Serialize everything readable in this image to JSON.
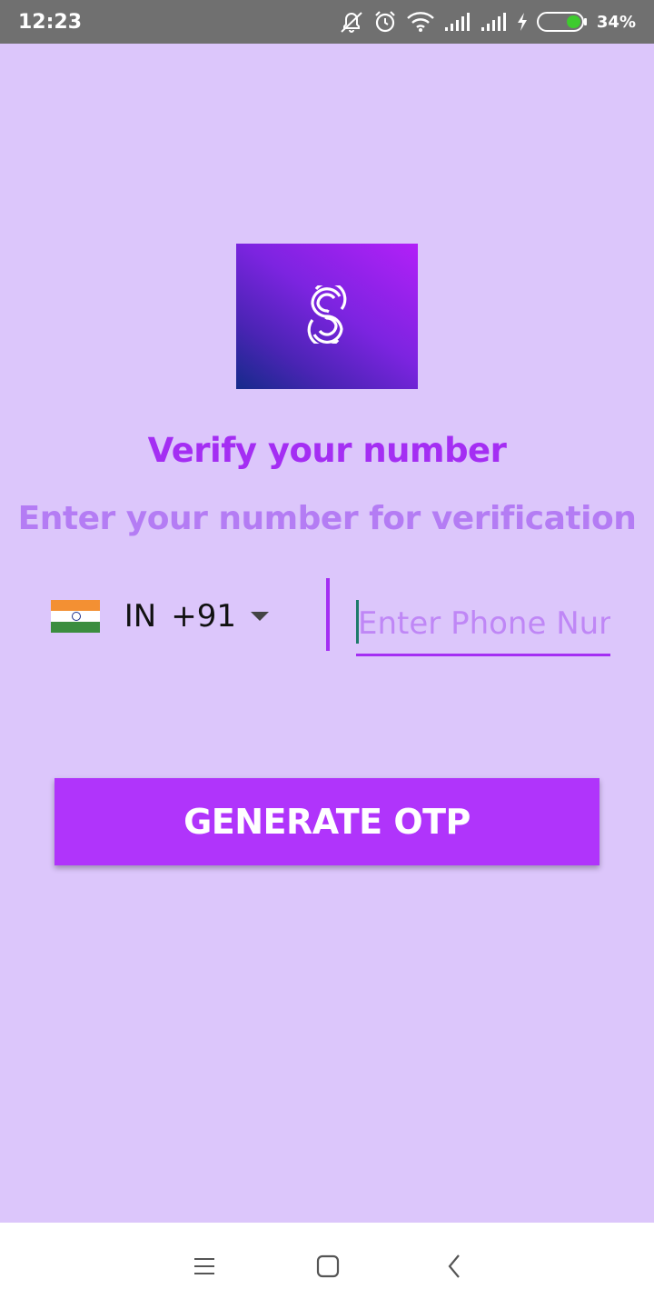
{
  "status_bar": {
    "time": "12:23",
    "battery_percent": "34%",
    "battery_level": 0.34,
    "icons": [
      "mute-icon",
      "alarm-icon",
      "wifi-icon",
      "signal-icon",
      "signal-icon",
      "charging-icon",
      "battery-icon"
    ]
  },
  "logo": {
    "icon": "app-logo-icon"
  },
  "verify": {
    "title": "Verify your number",
    "subtitle": "Enter your number for verification"
  },
  "country": {
    "flag": "india-flag-icon",
    "code": "IN",
    "dial_code": "+91"
  },
  "phone": {
    "placeholder": "Enter Phone Num",
    "value": ""
  },
  "button": {
    "label": "GENERATE OTP"
  },
  "colors": {
    "background": "#dcc6fb",
    "accent": "#a42ef3",
    "button": "#b034fb",
    "subtitle": "#b47cf4",
    "status_bar": "#707070"
  },
  "nav_bar": {
    "icons": [
      "menu-icon",
      "home-icon",
      "back-icon"
    ]
  }
}
